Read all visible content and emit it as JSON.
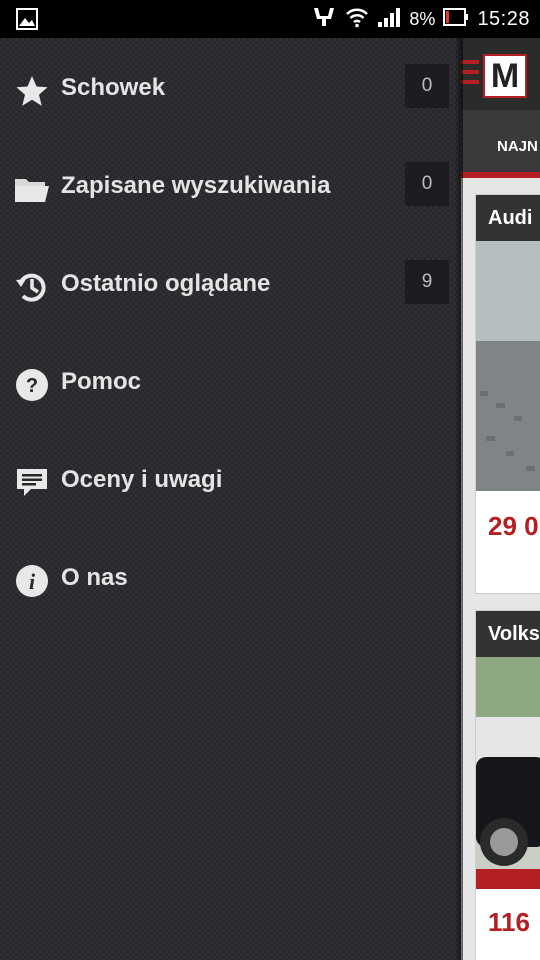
{
  "status_bar": {
    "battery_percent": "8%",
    "time": "15:28",
    "icons": [
      "gallery-icon",
      "usb-icon",
      "wifi-icon",
      "signal-icon",
      "battery-icon"
    ]
  },
  "drawer": {
    "items": [
      {
        "label": "Schowek",
        "icon": "star-icon",
        "count": "0"
      },
      {
        "label": "Zapisane wyszukiwania",
        "icon": "folder-icon",
        "count": "0"
      },
      {
        "label": "Ostatnio oglądane",
        "icon": "history-icon",
        "count": "9"
      },
      {
        "label": "Pomoc",
        "icon": "help-icon"
      },
      {
        "label": "Oceny i uwagi",
        "icon": "comment-icon"
      },
      {
        "label": "O nas",
        "icon": "info-icon"
      }
    ]
  },
  "background_app": {
    "logo_letter": "M",
    "tab_label": "NAJN",
    "cards": [
      {
        "title": "Audi",
        "price": "29 0"
      },
      {
        "title": "Volks",
        "price": "116"
      }
    ]
  },
  "colors": {
    "accent": "#b51e22",
    "drawer_bg": "#26282c",
    "count_bg": "#1c1d20"
  }
}
